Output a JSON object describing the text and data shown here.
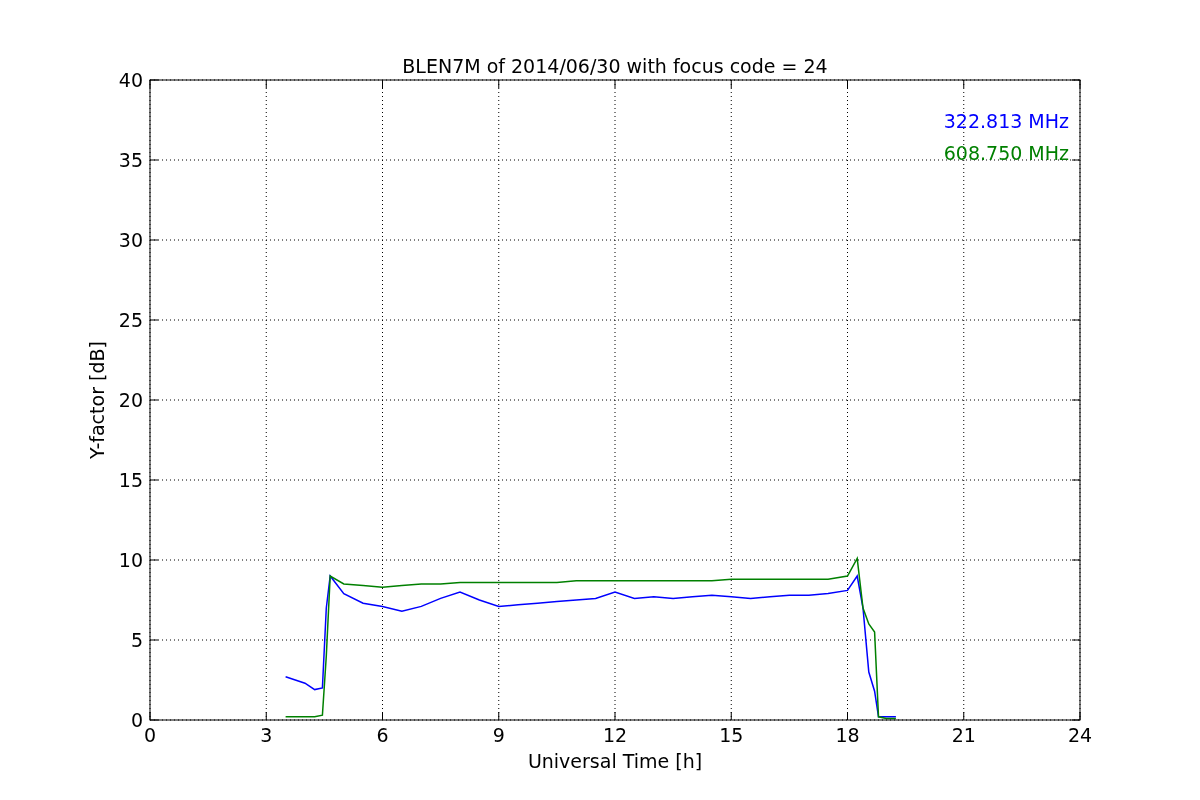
{
  "chart_data": {
    "type": "line",
    "grid": true,
    "title": "BLEN7M of 2014/06/30 with focus code = 24",
    "xlabel": "Universal Time [h]",
    "ylabel": "Y-factor [dB]",
    "xlim": [
      0,
      24
    ],
    "ylim": [
      0,
      40
    ],
    "xticks": [
      0,
      3,
      6,
      9,
      12,
      15,
      18,
      21,
      24
    ],
    "yticks": [
      0,
      5,
      10,
      15,
      20,
      25,
      30,
      35,
      40
    ],
    "x": [
      3.5,
      3.75,
      4,
      4.25,
      4.45,
      4.55,
      4.65,
      5,
      5.5,
      6,
      6.5,
      7,
      7.5,
      8,
      8.5,
      9,
      9.5,
      10,
      10.5,
      11,
      11.5,
      12,
      12.5,
      13,
      13.5,
      14,
      14.5,
      15,
      15.5,
      16,
      16.5,
      17,
      17.5,
      18,
      18.25,
      18.4,
      18.55,
      18.7,
      18.8,
      19,
      19.25
    ],
    "series": [
      {
        "name": "322.813 MHz",
        "color": "#0000ff",
        "values": [
          2.7,
          2.5,
          2.3,
          1.9,
          2.0,
          7,
          9,
          7.9,
          7.3,
          7.1,
          6.8,
          7.1,
          7.6,
          8.0,
          7.5,
          7.1,
          7.2,
          7.3,
          7.4,
          7.5,
          7.6,
          8.0,
          7.6,
          7.7,
          7.6,
          7.7,
          7.8,
          7.7,
          7.6,
          7.7,
          7.8,
          7.8,
          7.9,
          8.1,
          9.0,
          7,
          3,
          1.8,
          0.2,
          0.2,
          0.2
        ]
      },
      {
        "name": "608.750 MHz",
        "color": "#008000",
        "values": [
          0.2,
          0.2,
          0.2,
          0.2,
          0.3,
          4,
          9,
          8.5,
          8.4,
          8.3,
          8.4,
          8.5,
          8.5,
          8.6,
          8.6,
          8.6,
          8.6,
          8.6,
          8.6,
          8.7,
          8.7,
          8.7,
          8.7,
          8.7,
          8.7,
          8.7,
          8.7,
          8.8,
          8.8,
          8.8,
          8.8,
          8.8,
          8.8,
          9.0,
          10.1,
          7,
          6,
          5.5,
          0.2,
          0.1,
          0.1
        ]
      }
    ]
  }
}
